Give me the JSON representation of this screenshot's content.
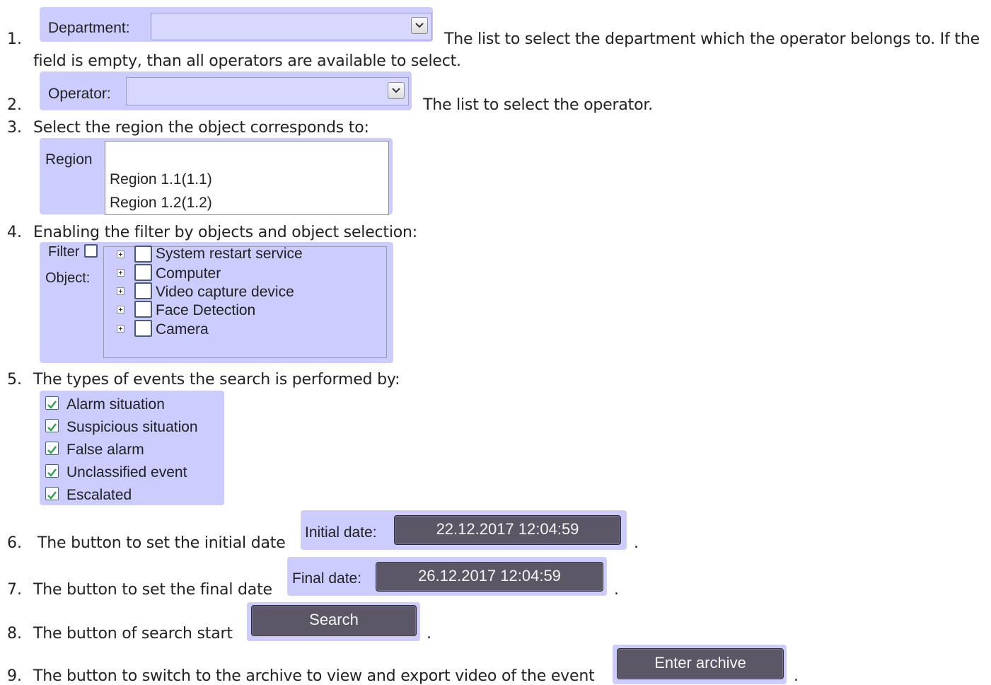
{
  "items": [
    {
      "number": "1.",
      "label": "Department:",
      "desc_line1": "The list to select the department which the operator belongs to. If the",
      "desc_line2": "field is empty, than all operators are available to select."
    },
    {
      "number": "2.",
      "label": "Operator:",
      "desc": "The list to select the operator."
    },
    {
      "number": "3.",
      "text": "Select the region the object corresponds to:",
      "region_label": "Region",
      "regions": [
        "Region 1.1(1.1)",
        "Region 1.2(1.2)"
      ]
    },
    {
      "number": "4.",
      "text": "Enabling the filter by objects and object selection:",
      "filter_label": "Filter",
      "object_label": "Object:",
      "objects": [
        "System restart service",
        "Computer",
        "Video capture device",
        "Face Detection",
        "Camera"
      ]
    },
    {
      "number": "5.",
      "text": "The types of events the search is performed by:",
      "events": [
        "Alarm situation",
        "Suspicious situation",
        "False alarm",
        "Unclassified event",
        "Escalated"
      ]
    },
    {
      "number": "6.",
      "text": "The button to set the initial date",
      "label": "Initial date:",
      "value": "22.12.2017 12:04:59"
    },
    {
      "number": "7.",
      "text": "The button to set the final date",
      "label": "Final date:",
      "value": "26.12.2017 12:04:59"
    },
    {
      "number": "8.",
      "text": "The button of search start",
      "button": "Search"
    },
    {
      "number": "9.",
      "text": "The button to switch to the archive to view and export video of the event",
      "button": "Enter archive"
    }
  ],
  "period": "."
}
